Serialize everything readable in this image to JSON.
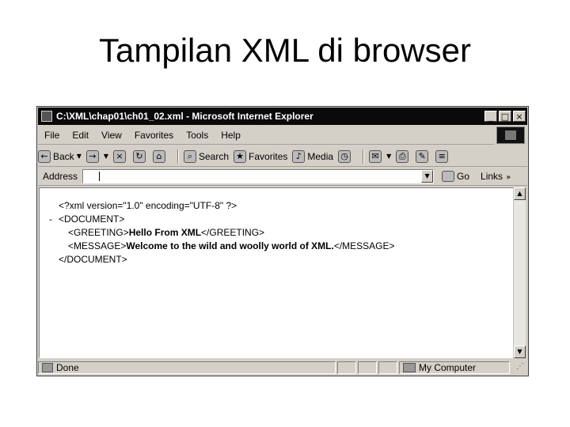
{
  "slide": {
    "title": "Tampilan XML di browser"
  },
  "window": {
    "title": "C:\\XML\\chap01\\ch01_02.xml - Microsoft Internet Explorer",
    "controls": {
      "minimize": "_",
      "maximize": "□",
      "close": "×"
    }
  },
  "menu": {
    "items": [
      {
        "label": "File"
      },
      {
        "label": "Edit"
      },
      {
        "label": "View"
      },
      {
        "label": "Favorites"
      },
      {
        "label": "Tools"
      },
      {
        "label": "Help"
      }
    ]
  },
  "toolbar": {
    "back_label": "Back",
    "search_label": "Search",
    "favorites_label": "Favorites",
    "media_label": "Media"
  },
  "address": {
    "label": "Address",
    "value": "",
    "go_label": "Go",
    "links_label": "Links"
  },
  "xml_view": {
    "declaration": "<?xml version=\"1.0\" encoding=\"UTF-8\" ?>",
    "collapse_marker": "-",
    "root_open": "<DOCUMENT>",
    "greeting_open": "<GREETING>",
    "greeting_text": "Hello From XML",
    "greeting_close": "</GREETING>",
    "message_open": "<MESSAGE>",
    "message_text": "Welcome to the wild and woolly world of XML.",
    "message_close": "</MESSAGE>",
    "root_close": "</DOCUMENT>"
  },
  "status": {
    "text": "Done",
    "zone": "My Computer"
  }
}
